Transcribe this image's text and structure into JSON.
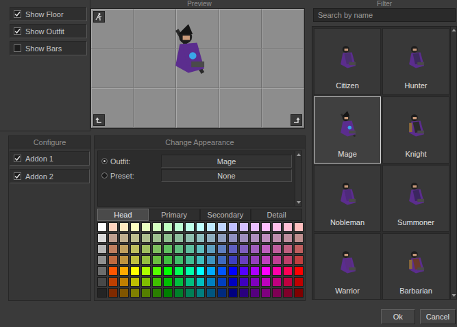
{
  "options": [
    {
      "label": "Show Floor",
      "checked": true
    },
    {
      "label": "Show Outfit",
      "checked": true
    },
    {
      "label": "Show Bars",
      "checked": false
    }
  ],
  "preview": {
    "title": "Preview"
  },
  "filter": {
    "title": "Filter",
    "search": {
      "placeholder": "Search by name"
    }
  },
  "outfits": [
    {
      "name": "Citizen",
      "selected": false
    },
    {
      "name": "Hunter",
      "selected": false
    },
    {
      "name": "Mage",
      "selected": true
    },
    {
      "name": "Knight",
      "selected": false
    },
    {
      "name": "Nobleman",
      "selected": false
    },
    {
      "name": "Summoner",
      "selected": false
    },
    {
      "name": "Warrior",
      "selected": false
    },
    {
      "name": "Barbarian",
      "selected": false
    }
  ],
  "configure": {
    "title": "Configure",
    "addons": [
      {
        "label": "Addon 1",
        "checked": true
      },
      {
        "label": "Addon 2",
        "checked": true
      }
    ]
  },
  "appearance": {
    "title": "Change Appearance",
    "rows": [
      {
        "label": "Outfit:",
        "value": "Mage",
        "selected": true
      },
      {
        "label": "Preset:",
        "value": "None",
        "selected": false
      }
    ]
  },
  "color_tabs": [
    {
      "label": "Head",
      "selected": true
    },
    {
      "label": "Primary",
      "selected": false
    },
    {
      "label": "Secondary",
      "selected": false
    },
    {
      "label": "Detail",
      "selected": false
    }
  ],
  "palette": [
    {
      "color": "#ffffff"
    },
    {
      "color": "#ffd4bf"
    },
    {
      "color": "#ffe9bf"
    },
    {
      "color": "#ffffbf"
    },
    {
      "color": "#e9ffbf"
    },
    {
      "color": "#d4ffbf"
    },
    {
      "color": "#bfffbf"
    },
    {
      "color": "#bfffd4"
    },
    {
      "color": "#bfffe9"
    },
    {
      "color": "#bfffff"
    },
    {
      "color": "#bfe9ff"
    },
    {
      "color": "#bfd4ff"
    },
    {
      "color": "#bfbfff"
    },
    {
      "color": "#d4bfff"
    },
    {
      "color": "#e9bfff"
    },
    {
      "color": "#ffbfff"
    },
    {
      "color": "#ffbfe9"
    },
    {
      "color": "#ffbfd4"
    },
    {
      "color": "#ffbfbf"
    },
    {
      "color": "#dadada"
    },
    {
      "color": "#bf9f8f"
    },
    {
      "color": "#bfaf8f"
    },
    {
      "color": "#bfbf8f"
    },
    {
      "color": "#afbf8f"
    },
    {
      "color": "#9fbf8f"
    },
    {
      "color": "#8fbf8f"
    },
    {
      "color": "#8fbf9f"
    },
    {
      "color": "#8fbfaf"
    },
    {
      "color": "#8fbfbf"
    },
    {
      "color": "#8fafbf"
    },
    {
      "color": "#8f9fbf"
    },
    {
      "color": "#8f8fbf"
    },
    {
      "color": "#9f8fbf"
    },
    {
      "color": "#af8fbf"
    },
    {
      "color": "#bf8fbf"
    },
    {
      "color": "#bf8faf"
    },
    {
      "color": "#bf8f9f"
    },
    {
      "color": "#bf8f8f"
    },
    {
      "color": "#b6b6b6"
    },
    {
      "color": "#bf7f5f"
    },
    {
      "color": "#bf9f5f"
    },
    {
      "color": "#bfbf5f"
    },
    {
      "color": "#9fbf5f"
    },
    {
      "color": "#7fbf5f"
    },
    {
      "color": "#5fbf5f"
    },
    {
      "color": "#5fbf7f"
    },
    {
      "color": "#5fbf9f"
    },
    {
      "color": "#5fbfbf"
    },
    {
      "color": "#5f9fbf"
    },
    {
      "color": "#5f7fbf"
    },
    {
      "color": "#5f5fbf"
    },
    {
      "color": "#7f5fbf"
    },
    {
      "color": "#9f5fbf"
    },
    {
      "color": "#bf5fbf"
    },
    {
      "color": "#bf5f9f"
    },
    {
      "color": "#bf5f7f"
    },
    {
      "color": "#bf5f5f"
    },
    {
      "color": "#919191"
    },
    {
      "color": "#bf6a3f"
    },
    {
      "color": "#bf943f"
    },
    {
      "color": "#bfbf3f"
    },
    {
      "color": "#94bf3f"
    },
    {
      "color": "#6abf3f"
    },
    {
      "color": "#3fbf3f"
    },
    {
      "color": "#3fbf6a"
    },
    {
      "color": "#3fbf94"
    },
    {
      "color": "#3fbfbf"
    },
    {
      "color": "#3f94bf"
    },
    {
      "color": "#3f6abf"
    },
    {
      "color": "#3f3fbf"
    },
    {
      "color": "#6a3fbf"
    },
    {
      "color": "#943fbf"
    },
    {
      "color": "#bf3fbf"
    },
    {
      "color": "#bf3f94"
    },
    {
      "color": "#bf3f6a"
    },
    {
      "color": "#bf3f3f"
    },
    {
      "color": "#6d6d6d"
    },
    {
      "color": "#ff5500"
    },
    {
      "color": "#ffaa00"
    },
    {
      "color": "#ffff00"
    },
    {
      "color": "#aaff00"
    },
    {
      "color": "#55ff00"
    },
    {
      "color": "#00ff00"
    },
    {
      "color": "#00ff55"
    },
    {
      "color": "#00ffaa"
    },
    {
      "color": "#00ffff"
    },
    {
      "color": "#00aaff"
    },
    {
      "color": "#0055ff"
    },
    {
      "color": "#0000ff"
    },
    {
      "color": "#5500ff"
    },
    {
      "color": "#aa00ff"
    },
    {
      "color": "#ff00ff"
    },
    {
      "color": "#ff00aa"
    },
    {
      "color": "#ff0055"
    },
    {
      "color": "#ff0000"
    },
    {
      "color": "#484848"
    },
    {
      "color": "#bf3f00"
    },
    {
      "color": "#bf7f00"
    },
    {
      "color": "#bfbf00"
    },
    {
      "color": "#7fbf00"
    },
    {
      "color": "#3fbf00"
    },
    {
      "color": "#00bf00"
    },
    {
      "color": "#00bf3f"
    },
    {
      "color": "#00bf7f"
    },
    {
      "color": "#00bfbf"
    },
    {
      "color": "#007fbf"
    },
    {
      "color": "#003fbf"
    },
    {
      "color": "#0000bf"
    },
    {
      "color": "#3f00bf"
    },
    {
      "color": "#7f00bf"
    },
    {
      "color": "#bf00bf"
    },
    {
      "color": "#bf007f"
    },
    {
      "color": "#bf003f"
    },
    {
      "color": "#bf0000"
    },
    {
      "color": "#242424"
    },
    {
      "color": "#7f2a00"
    },
    {
      "color": "#7f5500"
    },
    {
      "color": "#7f7f00"
    },
    {
      "color": "#557f00"
    },
    {
      "color": "#2a7f00"
    },
    {
      "color": "#007f00"
    },
    {
      "color": "#007f2a"
    },
    {
      "color": "#007f55"
    },
    {
      "color": "#007f7f"
    },
    {
      "color": "#00557f"
    },
    {
      "color": "#002a7f"
    },
    {
      "color": "#00007f"
    },
    {
      "color": "#2a007f"
    },
    {
      "color": "#55007f"
    },
    {
      "color": "#7f007f"
    },
    {
      "color": "#7f0055"
    },
    {
      "color": "#7f002a"
    },
    {
      "color": "#7f0000"
    }
  ],
  "buttons": [
    "Ok",
    "Cancel"
  ]
}
